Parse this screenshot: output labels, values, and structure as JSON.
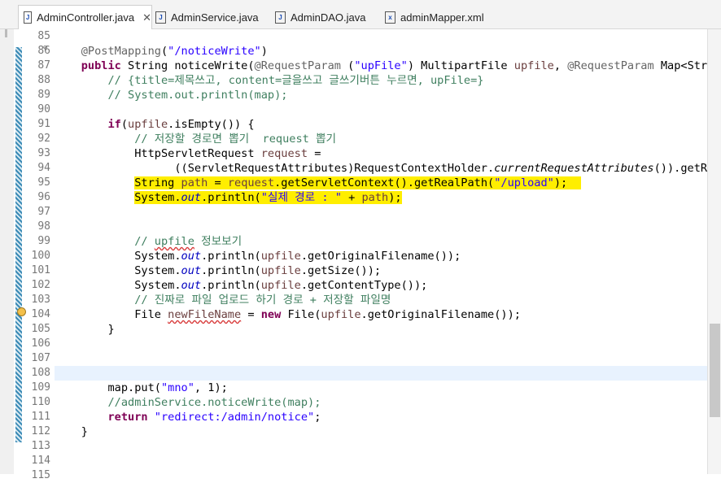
{
  "tabs": [
    {
      "label": "AdminController.java",
      "icon": "J",
      "active": true
    },
    {
      "label": "AdminService.java",
      "icon": "J"
    },
    {
      "label": "AdminDAO.java",
      "icon": "J"
    },
    {
      "label": "adminMapper.xml",
      "icon": "x"
    }
  ],
  "close_glyph": "✕",
  "line_numbers": [
    "85",
    "86",
    "87",
    "88",
    "89",
    "90",
    "91",
    "92",
    "93",
    "94",
    "95",
    "96",
    "97",
    "98",
    "99",
    "100",
    "101",
    "102",
    "103",
    "104",
    "105",
    "106",
    "107",
    "108",
    "109",
    "110",
    "111",
    "112",
    "113",
    "114",
    "115"
  ],
  "fold_marker": "⊖",
  "code": {
    "l86_ann": "@PostMapping",
    "l86_open": "(",
    "l86_str": "\"/noticeWrite\"",
    "l86_close": ")",
    "l87_kw": "public",
    "l87_a": " String noticeWrite(",
    "l87_ann": "@RequestParam",
    "l87_b": " (",
    "l87_str": "\"upFile\"",
    "l87_c": ") MultipartFile ",
    "l87_var": "upfile",
    "l87_d": ", ",
    "l87_ann2": "@RequestParam",
    "l87_e": " Map<String",
    "l88": "// {title=제목쓰고, content=글을쓰고 글쓰기버튼 누르면, upFile=}",
    "l89": "// System.out.println(map);",
    "l91_kw": "if",
    "l91_a": "(",
    "l91_var": "upfile",
    "l91_b": ".isEmpty()) {",
    "l92": "// 저장할 경로면 뽑기  request 뽑기",
    "l93_a": "HttpServletRequest ",
    "l93_var": "request",
    "l93_b": " =",
    "l94_a": "((ServletRequestAttributes)RequestContextHolder.",
    "l94_it": "currentRequestAttributes",
    "l94_b": "()).getRe",
    "l95_a": "String ",
    "l95_var": "path",
    "l95_b": " = ",
    "l95_var2": "request",
    "l95_c": ".getServletContext().getRealPath(",
    "l95_str": "\"/upload\"",
    "l95_d": ");",
    "l96_a": "System.",
    "l96_fd": "out",
    "l96_b": ".println(",
    "l96_str": "\"실제 경로 : \"",
    "l96_c": " + ",
    "l96_var": "path",
    "l96_d": ");",
    "l99_a": "// ",
    "l99_sq": "upfile",
    "l99_b": " 정보보기",
    "l100_a": "System.",
    "l100_fd": "out",
    "l100_b": ".println(",
    "l100_var": "upfile",
    "l100_c": ".getOriginalFilename());",
    "l101_a": "System.",
    "l101_fd": "out",
    "l101_b": ".println(",
    "l101_var": "upfile",
    "l101_c": ".getSize());",
    "l102_a": "System.",
    "l102_fd": "out",
    "l102_b": ".println(",
    "l102_var": "upfile",
    "l102_c": ".getContentType());",
    "l103": "// 진짜로 파일 업로드 하기 경로 + 저장할 파일명",
    "l104_a": "File ",
    "l104_var": "newFileName",
    "l104_b": " = ",
    "l104_kw": "new",
    "l104_c": " File(",
    "l104_var2": "upfile",
    "l104_d": ".getOriginalFilename());",
    "l105": "}",
    "l109_a": "map.put(",
    "l109_str": "\"mno\"",
    "l109_b": ", 1);",
    "l110": "//adminService.noticeWrite(map);",
    "l111_kw": "return",
    "l111_sp": " ",
    "l111_str": "\"redirect:/admin/notice\"",
    "l111_b": ";",
    "l112": "}"
  }
}
